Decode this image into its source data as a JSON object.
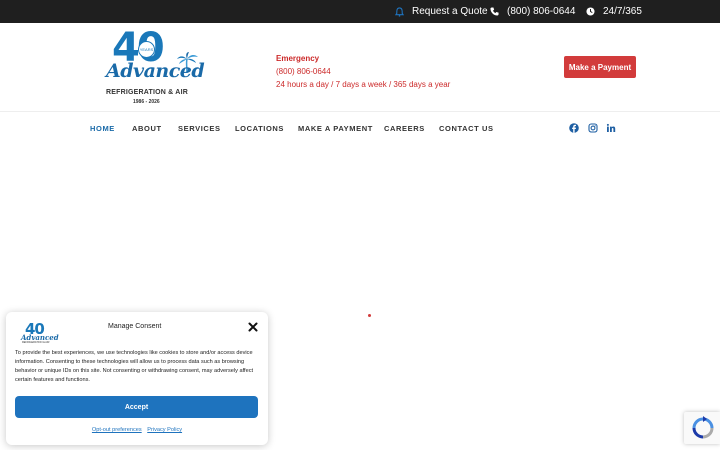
{
  "topbar": {
    "quote_label": "Request a Quote",
    "phone_label": "(800) 806-0644",
    "hours_label": "24/7/365"
  },
  "logo": {
    "number": "40",
    "years_badge": "YEARS",
    "brand": "Advanced",
    "subtitle": "REFRIGERATION & AIR",
    "years_range": "1986 - 2026"
  },
  "emergency": {
    "title": "Emergency",
    "phone": "(800) 806-0644",
    "hours": "24 hours a day / 7 days a week / 365 days a year"
  },
  "header": {
    "payment_button": "Make a Payment"
  },
  "nav": {
    "items": [
      {
        "label": "HOME"
      },
      {
        "label": "ABOUT"
      },
      {
        "label": "SERVICES"
      },
      {
        "label": "LOCATIONS"
      },
      {
        "label": "MAKE A PAYMENT"
      },
      {
        "label": "CAREERS"
      },
      {
        "label": "CONTACT US"
      }
    ],
    "social": [
      "facebook-icon",
      "instagram-icon",
      "linkedin-icon"
    ]
  },
  "consent": {
    "title": "Manage Consent",
    "text": "To provide the best experiences, we use technologies like cookies to store and/or access device information. Consenting to these technologies will allow us to process data such as browsing behavior or unique IDs on this site. Not consenting or withdrawing consent, may adversely affect certain features and functions.",
    "accept_label": "Accept",
    "optout_label": "Opt-out preferences",
    "privacy_label": "Privacy Policy"
  },
  "colors": {
    "accent_blue": "#1e73be",
    "accent_red": "#d23b3b",
    "topbar_bg": "#1f1f1f"
  }
}
